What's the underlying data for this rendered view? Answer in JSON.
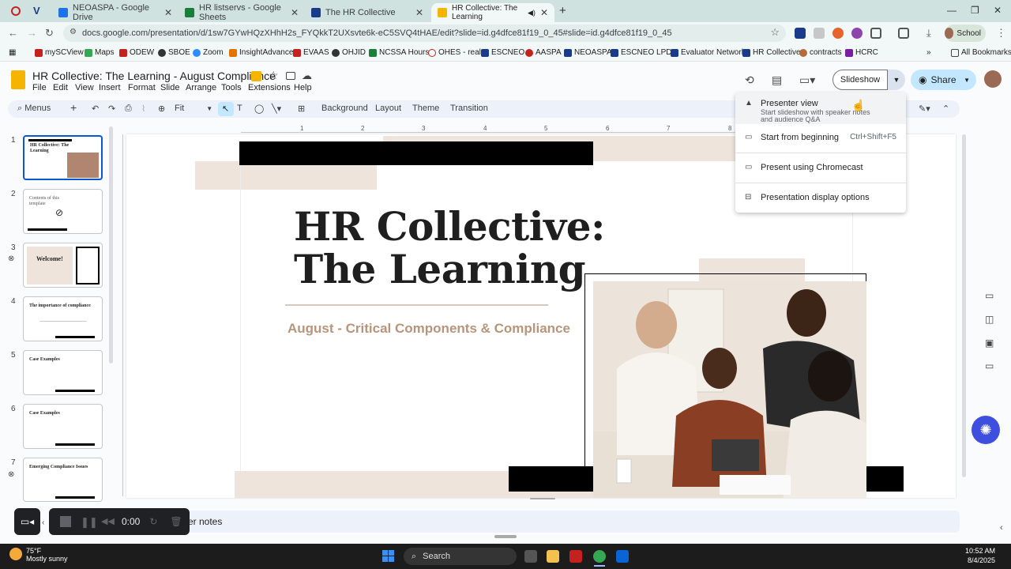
{
  "browser": {
    "tabs": [
      {
        "title": "NEOASPA - Google Drive",
        "favicon_color": "#1a73e8"
      },
      {
        "title": "HR listservs - Google Sheets",
        "favicon_color": "#188038"
      },
      {
        "title": "The HR Collective",
        "favicon_color": "#1a3a8a"
      },
      {
        "title": "HR Collective: The Learning",
        "favicon_color": "#f4b400",
        "active": true
      }
    ],
    "url": "docs.google.com/presentation/d/1sw7GYwHQzXHhH2s_FYQkkT2UXsvte6k-eC5SVQ4tHAE/edit?slide=id.g4dfce81f19_0_45#slide=id.g4dfce81f19_0_45",
    "profile_label": "School",
    "bookmarks": [
      "mySCView",
      "Maps",
      "ODEW",
      "SBOE",
      "Zoom",
      "InsightAdvance",
      "EVAAS",
      "OHJID",
      "NCSSA Hours",
      "OHES - real",
      "ESCNEO",
      "AASPA",
      "NEOASPA",
      "ESCNEO LPDC",
      "Evaluator Network",
      "HR Collective",
      "contracts",
      "HCRC"
    ],
    "all_bookmarks": "All Bookmarks"
  },
  "doc": {
    "title": "HR Collective: The Learning  - August Compliance",
    "menus": [
      "File",
      "Edit",
      "View",
      "Insert",
      "Format",
      "Slide",
      "Arrange",
      "Tools",
      "Extensions",
      "Help"
    ],
    "slideshow_label": "Slideshow",
    "share_label": "Share"
  },
  "toolbar": {
    "menus_label": "Menus",
    "zoom": "Fit",
    "background": "Background",
    "layout": "Layout",
    "theme": "Theme",
    "transition": "Transition"
  },
  "ruler": [
    "1",
    "2",
    "3",
    "4",
    "5",
    "6",
    "7",
    "8"
  ],
  "slides": [
    {
      "num": "1",
      "title": "HR Collective: The Learning"
    },
    {
      "num": "2",
      "title": "Contents of this template"
    },
    {
      "num": "3",
      "title": "Welcome!"
    },
    {
      "num": "4",
      "title": "The importance of compliance"
    },
    {
      "num": "5",
      "title": "Case Examples"
    },
    {
      "num": "6",
      "title": "Case Examples"
    },
    {
      "num": "7",
      "title": "Emerging Compliance Issues"
    }
  ],
  "slide": {
    "title_line1": "HR Collective:",
    "title_line2": "The Learning",
    "subtitle": "August - Critical Components & Compliance"
  },
  "dropdown": {
    "presenter_view": "Presenter view",
    "presenter_view_sub": "Start slideshow with speaker notes and audience Q&A",
    "start_beginning": "Start from beginning",
    "start_shortcut": "Ctrl+Shift+F5",
    "chromecast": "Present using Chromecast",
    "display_options": "Presentation display options"
  },
  "notes_label": "ker notes",
  "recorder": {
    "time": "0:00"
  },
  "taskbar": {
    "temp": "75°F",
    "weather": "Mostly sunny",
    "search": "Search",
    "time": "10:52 AM",
    "date": "8/4/2025"
  },
  "colors": {
    "accent": "#0b57d0",
    "slide_tan": "#efe4dc",
    "subtitle": "#b8957a",
    "share": "#c2e7ff"
  }
}
